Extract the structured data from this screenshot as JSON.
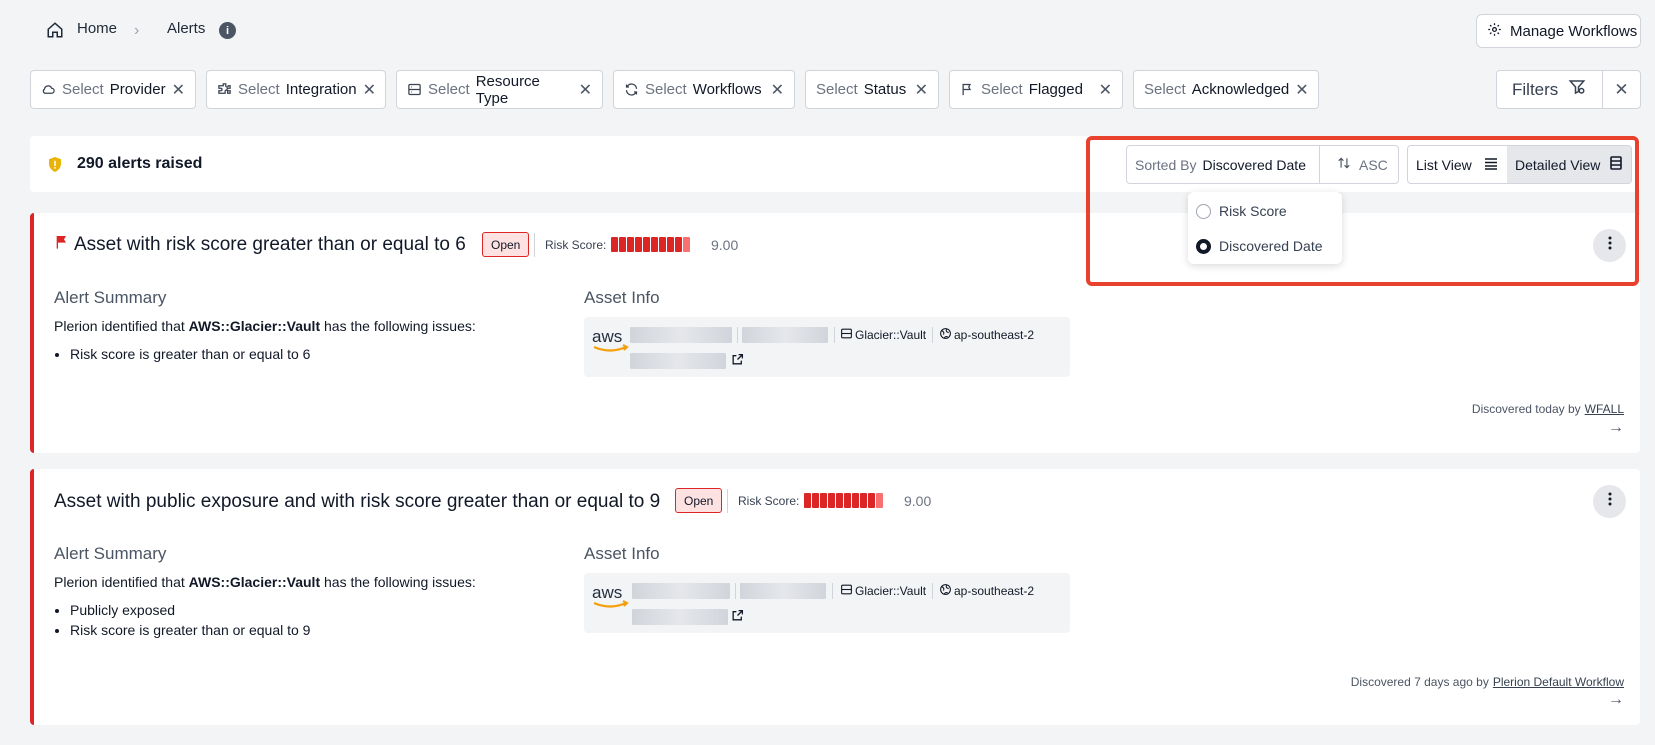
{
  "breadcrumb": {
    "home": "Home",
    "separator": "›",
    "current": "Alerts",
    "info": "i"
  },
  "manage_workflows": "Manage Workflows",
  "filters": [
    {
      "pre": "Select",
      "main": "Provider",
      "icon": "cloud-icon"
    },
    {
      "pre": "Select",
      "main": "Integration",
      "icon": "puzzle-icon"
    },
    {
      "pre": "Select",
      "main": "Resource Type",
      "icon": "server-icon"
    },
    {
      "pre": "Select",
      "main": "Workflows",
      "icon": "refresh-icon"
    },
    {
      "pre": "Select",
      "main": "Status",
      "icon": ""
    },
    {
      "pre": "Select",
      "main": "Flagged",
      "icon": "flag-icon"
    },
    {
      "pre": "Select",
      "main": "Acknowledged",
      "icon": ""
    }
  ],
  "filters_button": "Filters",
  "alert_count": "290 alerts raised",
  "sort": {
    "label": "Sorted By",
    "value": "Discovered Date",
    "direction": "ASC"
  },
  "view": {
    "list": "List View",
    "detailed": "Detailed View",
    "selected": "Detailed View"
  },
  "sort_options": [
    {
      "label": "Risk Score",
      "selected": false
    },
    {
      "label": "Discovered Date",
      "selected": true
    }
  ],
  "alerts": [
    {
      "title": "Asset with risk score greater than or equal to 6",
      "flagged": true,
      "status": "Open",
      "risk_label": "Risk Score:",
      "risk_value": "9.00",
      "risk_score": 9.0,
      "summary_heading": "Alert Summary",
      "summary_pre": "Plerion identified that ",
      "summary_asset": "AWS::Glacier::Vault",
      "summary_post": " has the following issues:",
      "issues": [
        "Risk score is greater than or equal to 6"
      ],
      "asset_heading": "Asset Info",
      "resource_type": "Glacier::Vault",
      "region": "ap-southeast-2",
      "discovered": "Discovered today by",
      "workflow": "WFALL"
    },
    {
      "title": "Asset with public exposure and with risk score greater than or equal to 9",
      "flagged": false,
      "status": "Open",
      "risk_label": "Risk Score:",
      "risk_value": "9.00",
      "risk_score": 9.0,
      "summary_heading": "Alert Summary",
      "summary_pre": "Plerion identified that ",
      "summary_asset": "AWS::Glacier::Vault",
      "summary_post": " has the following issues:",
      "issues": [
        "Publicly exposed",
        "Risk score is greater than or equal to 9"
      ],
      "asset_heading": "Asset Info",
      "resource_type": "Glacier::Vault",
      "region": "ap-southeast-2",
      "discovered": "Discovered 7 days ago by",
      "workflow": "Plerion Default Workflow"
    }
  ],
  "colors": {
    "accent_red": "#dc2626",
    "highlight": "#e8412e",
    "shield": "#eab308"
  }
}
